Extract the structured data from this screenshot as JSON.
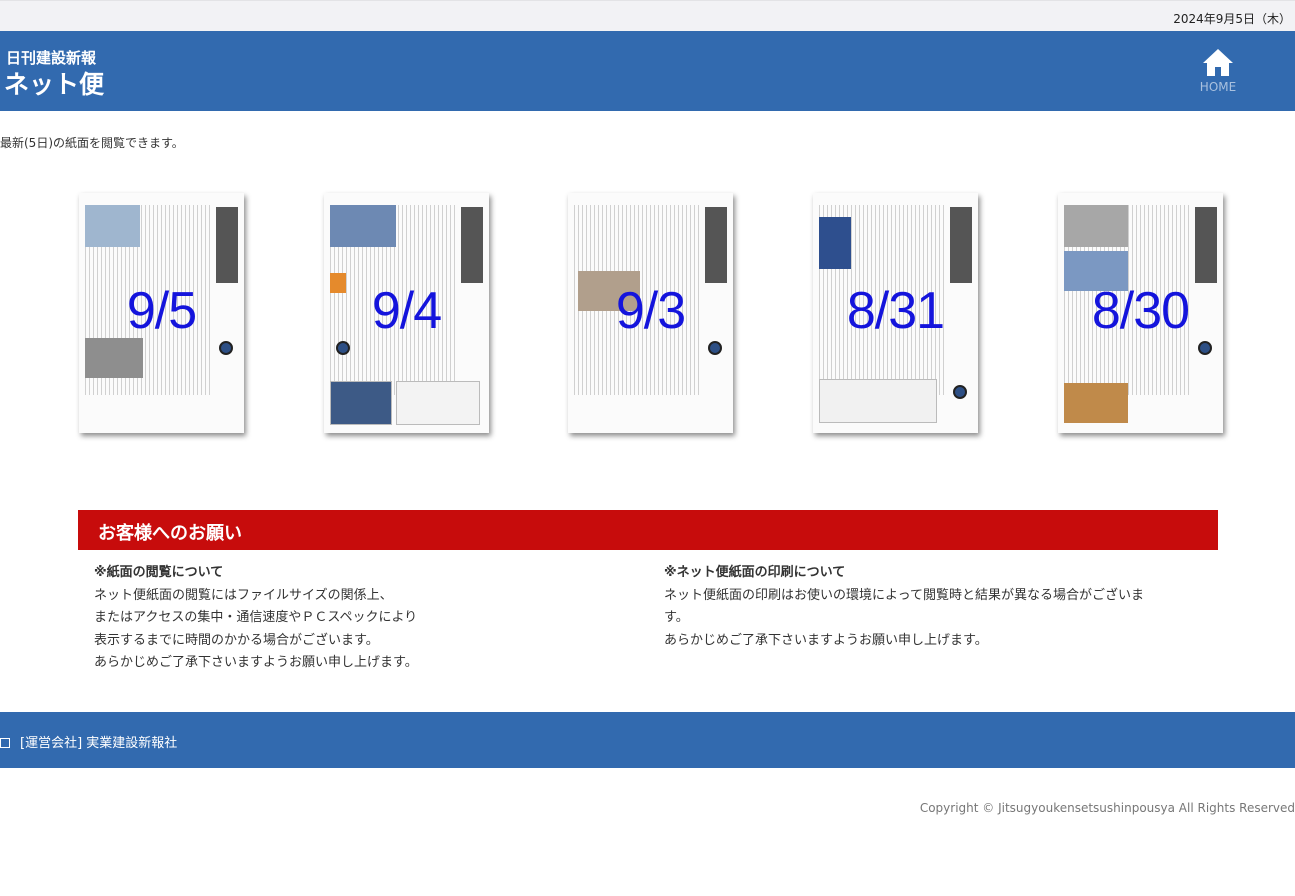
{
  "top": {
    "date": "2024年9月5日（木）"
  },
  "header": {
    "brand_sub": "日刊建設新報",
    "brand_main": "ネット便",
    "home_label": "HOME",
    "color": "#326aaf"
  },
  "intro": "最新(5日)の紙面を閲覧できます。",
  "papers": [
    {
      "label": "9/5"
    },
    {
      "label": "9/4"
    },
    {
      "label": "9/3"
    },
    {
      "label": "8/31"
    },
    {
      "label": "8/30"
    }
  ],
  "notice": {
    "title": "お客様へのお願い",
    "color": "#c70c0c",
    "left": {
      "title": "※紙面の閲覧について",
      "lines": [
        "ネット便紙面の閲覧にはファイルサイズの関係上、",
        "またはアクセスの集中・通信速度やＰＣスペックにより",
        "表示するまでに時間のかかる場合がございます。",
        "あらかじめご了承下さいますようお願い申し上げます。"
      ]
    },
    "right": {
      "title": "※ネット便紙面の印刷について",
      "lines": [
        "ネット便紙面の印刷はお使いの環境によって閲覧時と結果が異なる場合がございま",
        "す。",
        "あらかじめご了承下さいますようお願い申し上げます。"
      ]
    }
  },
  "footer": {
    "company": "[運営会社] 実業建設新報社",
    "copyright": "Copyright © Jitsugyoukensetsushinpousya All Rights Reserved"
  },
  "icons": {
    "home": "home-icon"
  }
}
